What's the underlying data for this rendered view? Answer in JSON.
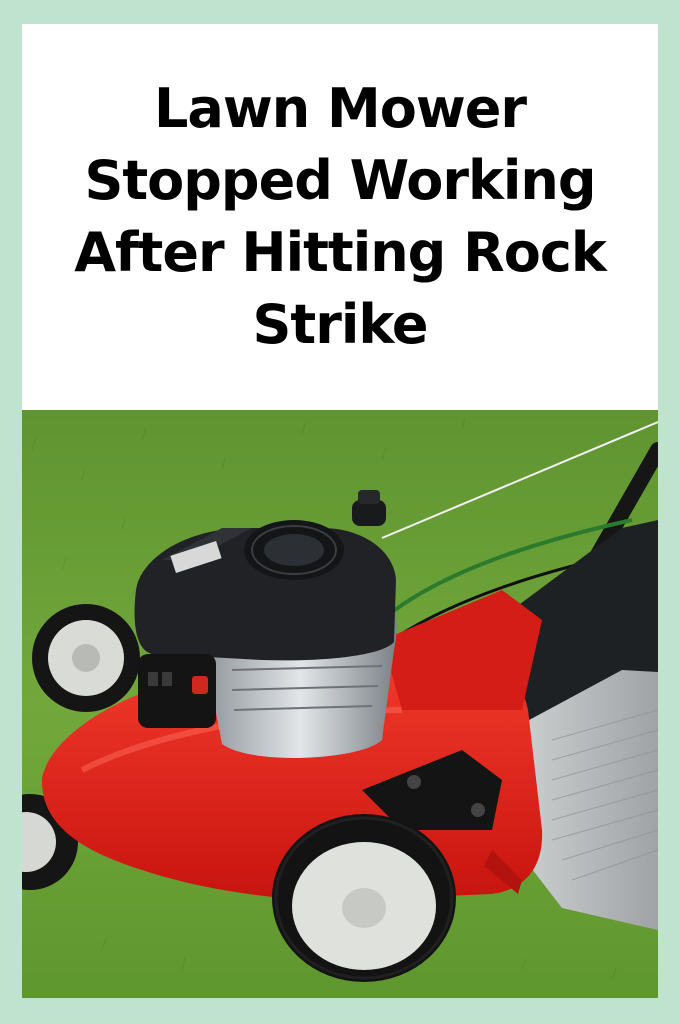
{
  "pin": {
    "title": "Lawn Mower Stopped Working After Hitting Rock Strike",
    "image": {
      "subject": "red-push-lawn-mower-on-grass",
      "colors": {
        "frame": "#bfe3cf",
        "grass": "#6fa33a",
        "deck": "#e4201c",
        "engine": "#1e1f22",
        "bag": "#b9bcbd"
      }
    }
  }
}
